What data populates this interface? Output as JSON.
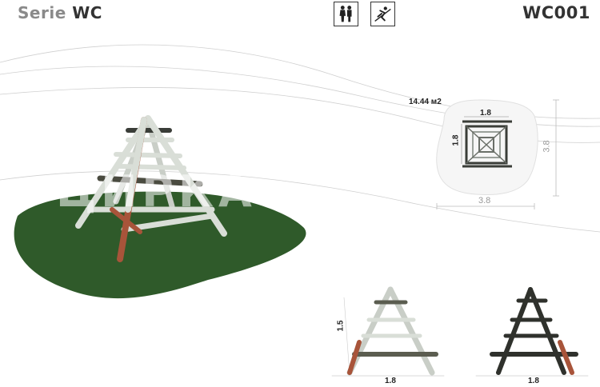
{
  "header": {
    "series_prefix": "Serie",
    "series_code": "WC",
    "product_code": "WC001",
    "icons": [
      "people-icon",
      "slide-activity-icon"
    ]
  },
  "plan": {
    "area": "14.44 м2",
    "inner_width": "1.8",
    "inner_depth": "1.8",
    "outer_width": "3.8",
    "outer_depth": "3.8"
  },
  "elevations": {
    "height": "1.5",
    "front_width": "1.8",
    "side_width": "1.8"
  },
  "watermark": "ЦИРКА",
  "colors": {
    "grass": "#2f5a2a",
    "log": "#d9ded7",
    "log_dark": "#3a3d38",
    "accent_paint": "#a8543a"
  }
}
